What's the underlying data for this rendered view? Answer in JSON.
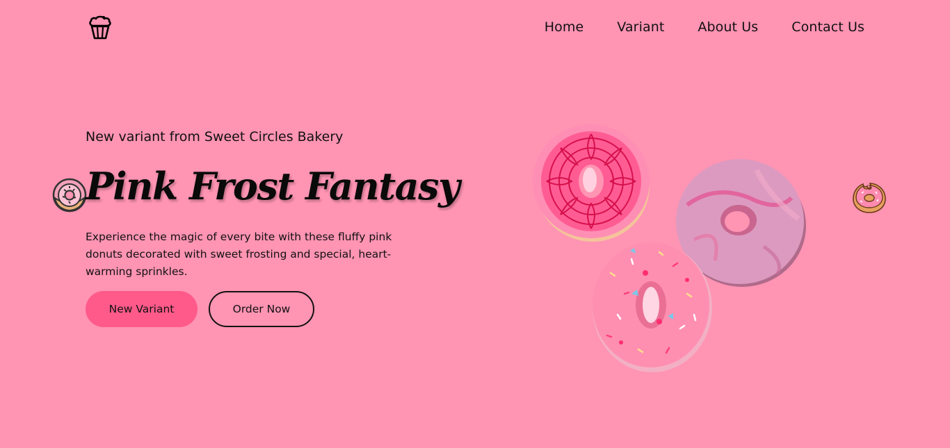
{
  "nav": {
    "logo_icon": "cupcake-icon",
    "items": [
      {
        "label": "Home"
      },
      {
        "label": "Variant"
      },
      {
        "label": "About Us"
      },
      {
        "label": "Contact Us"
      }
    ]
  },
  "hero": {
    "eyebrow": "New variant from Sweet Circles Bakery",
    "title": "Pink Frost Fantasy",
    "description": "Experience the magic of every bite with these fluffy pink donuts decorated with sweet frosting and special, heart-warming sprinkles.",
    "primary_button": "New Variant",
    "secondary_button": "Order Now"
  },
  "decor": {
    "left_icon": "donut-icon",
    "right_icon": "bitten-donut-icon",
    "images": [
      "red-glazed-donut",
      "marbled-pink-donut",
      "sprinkled-pink-donut"
    ]
  },
  "colors": {
    "background": "#ff94b3",
    "accent": "#ff5a8a",
    "text": "#111111"
  }
}
